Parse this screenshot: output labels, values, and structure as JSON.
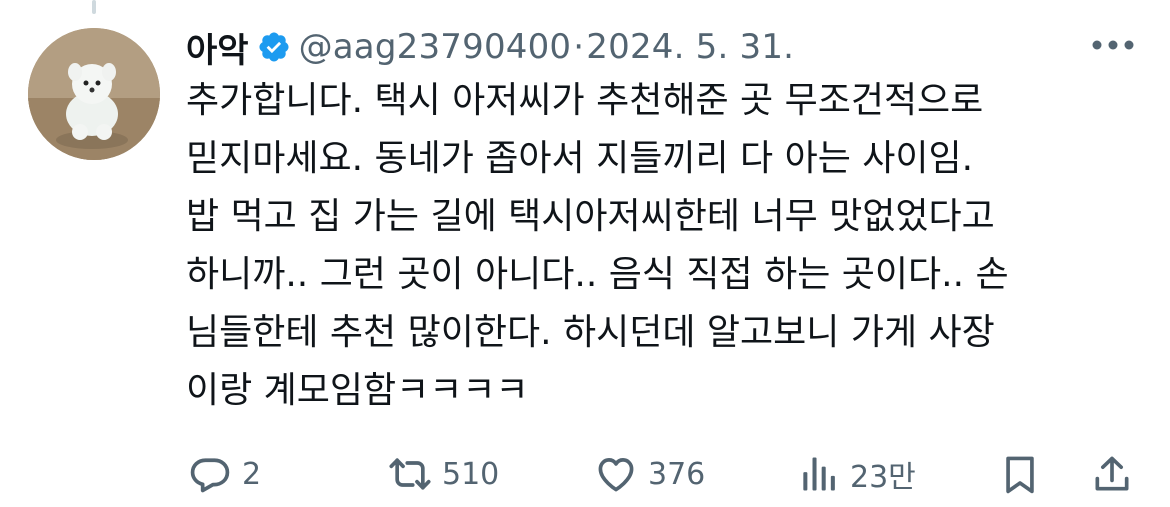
{
  "tweet": {
    "display_name": "아악",
    "handle": "@aag23790400",
    "separator": "·",
    "date": "2024. 5. 31.",
    "text": "추가합니다. 택시 아저씨가 추천해준 곳 무조건적으로\n믿지마세요. 동네가 좁아서 지들끼리 다 아는 사이임.\n밥 먹고 집 가는 길에 택시아저씨한테 너무 맛없었다고\n하니까.. 그런 곳이 아니다.. 음식 직접 하는 곳이다.. 손\n님들한테 추천 많이한다. 하시던데 알고보니 가게 사장\n이랑 계모임함ㅋㅋㅋㅋ"
  },
  "actions": {
    "reply_count": "2",
    "retweet_count": "510",
    "like_count": "376",
    "views_count": "23만"
  },
  "icons": {
    "verified": "verified-badge-icon",
    "more": "more-options-icon",
    "reply": "reply-bubble-icon",
    "retweet": "retweet-arrows-icon",
    "like": "heart-icon",
    "views": "bar-chart-icon",
    "bookmark": "bookmark-icon",
    "share": "share-upload-icon"
  },
  "colors": {
    "text": "#0f1419",
    "secondary": "#536471",
    "verified_blue": "#1d9bf0",
    "thread_line": "#cfd9de"
  }
}
